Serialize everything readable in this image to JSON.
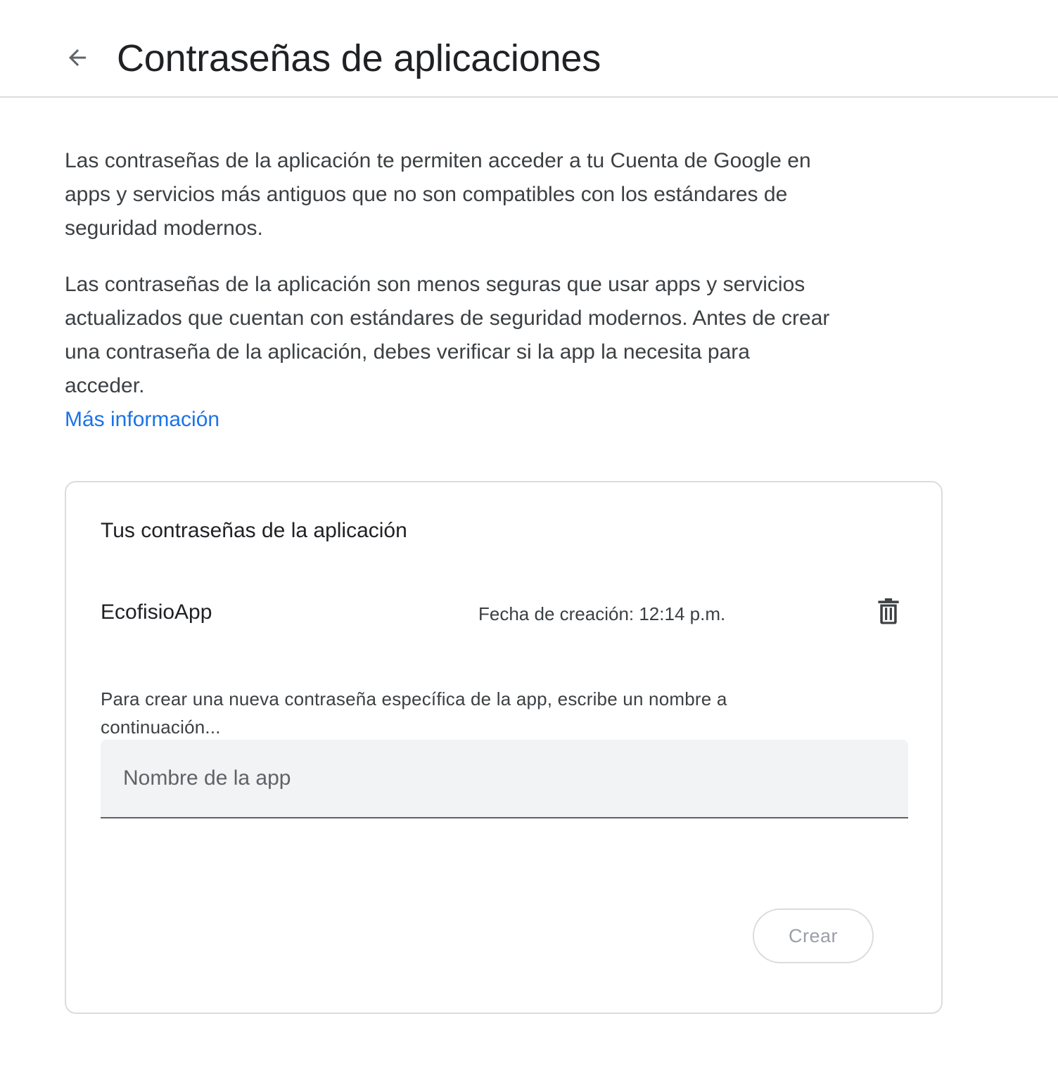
{
  "header": {
    "back_icon": "arrow-back-icon",
    "title": "Contraseñas de aplicaciones"
  },
  "intro": {
    "paragraph1": "Las contraseñas de la aplicación te permiten acceder a tu Cuenta de Google en apps y servicios más antiguos que no son compatibles con los estándares de seguridad modernos.",
    "paragraph2": "Las contraseñas de la aplicación son menos seguras que usar apps y servicios actualizados que cuentan con estándares de seguridad modernos. Antes de crear una contraseña de la aplicación, debes verificar si la app la necesita para acceder.",
    "learn_more": "Más información",
    "link_color": "#1a73e8"
  },
  "card": {
    "title": "Tus contraseñas de la aplicación",
    "passwords": [
      {
        "name": "EcofisioApp",
        "created": "Fecha de creación: 12:14 p.m.",
        "delete_icon": "trash-icon"
      }
    ],
    "help_text": "Para crear una nueva contraseña específica de la app, escribe un nombre a continuación...",
    "input": {
      "placeholder": "Nombre de la app",
      "value": ""
    },
    "create_label": "Crear"
  }
}
